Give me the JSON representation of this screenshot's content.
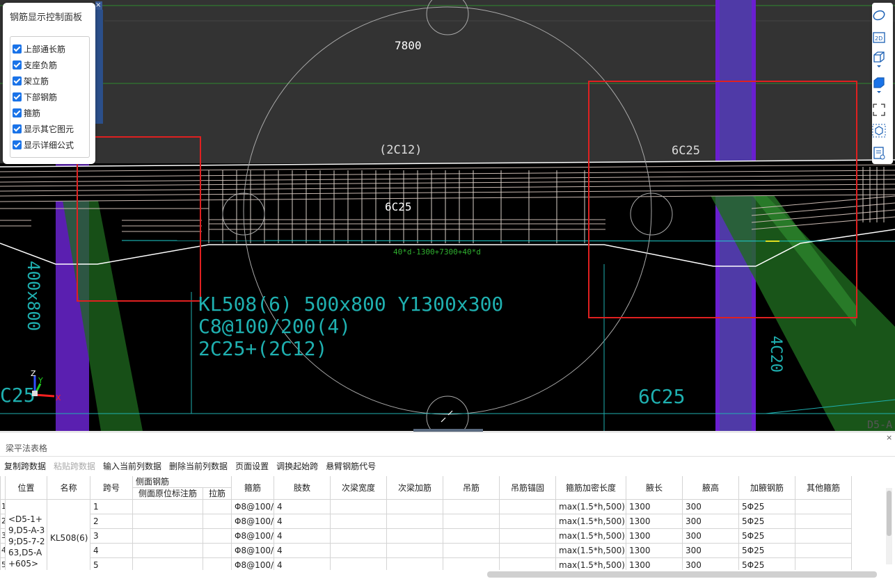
{
  "viewport": {
    "label_7800": "7800",
    "label_2c12": "(2C12)",
    "label_6c25_top": "6C25",
    "label_6c25_mid": "6C25",
    "label_6c25_bottom": "6C25",
    "label_c25_left": "C25",
    "beam_line1": "KL508(6) 500x800 Y1300x300",
    "beam_line2": "C8@100/200(4)",
    "beam_line3": "2C25+(2C12)",
    "green_formula_line2": "40*d-1300+7300+40*d",
    "left_vertical_text": "400x800",
    "right_vertical_text": "4C20",
    "corner_text": "D5-A",
    "axis_z": "Z",
    "axis_y": "Y",
    "axis_x": "X",
    "colors": {
      "bg": "#000000",
      "cyan": "#1fb0b0",
      "red": "#e02020",
      "purple": "#7a1fe0",
      "green": "#2f8a2f"
    }
  },
  "control_panel": {
    "title": "钢筋显示控制面板",
    "close_label": "×",
    "items": [
      {
        "label": "上部通长筋",
        "checked": true
      },
      {
        "label": "支座负筋",
        "checked": true
      },
      {
        "label": "架立筋",
        "checked": true
      },
      {
        "label": "下部钢筋",
        "checked": true
      },
      {
        "label": "箍筋",
        "checked": true
      },
      {
        "label": "显示其它图元",
        "checked": true
      },
      {
        "label": "显示详细公式",
        "checked": true
      }
    ]
  },
  "right_toolbar": {
    "icons": [
      "orbit-icon",
      "2d-view-icon",
      "3d-box-icon",
      "3d-solid-icon",
      "fullscreen-icon",
      "cube-view-icon",
      "report-icon"
    ],
    "label_2d": "2D"
  },
  "panel": {
    "title": "梁平法表格",
    "close_label": "×",
    "menu": [
      {
        "label": "复制跨数据",
        "enabled": true
      },
      {
        "label": "粘贴跨数据",
        "enabled": false
      },
      {
        "label": "输入当前列数据",
        "enabled": true
      },
      {
        "label": "删除当前列数据",
        "enabled": true
      },
      {
        "label": "页面设置",
        "enabled": true
      },
      {
        "label": "调换起始跨",
        "enabled": true
      },
      {
        "label": "悬臂钢筋代号",
        "enabled": true
      }
    ],
    "headers": {
      "position": "位置",
      "name": "名称",
      "span": "跨号",
      "side_group": "侧面钢筋",
      "side_orig": "侧面原位标注筋",
      "tie": "拉筋",
      "stirrup": "箍筋",
      "legs": "肢数",
      "sec_width": "次梁宽度",
      "sec_add": "次梁加筋",
      "hanger": "吊筋",
      "hanger_anchor": "吊筋锚固",
      "dense_len": "箍筋加密长度",
      "haunch_len": "腋长",
      "haunch_h": "腋高",
      "haunch_bar": "加腋钢筋",
      "other_stirrup": "其他箍筋"
    },
    "position_text": "<D5-1+9,D5-A-39;D5-7-263,D5-A+605>",
    "name_text": "KL508(6)",
    "rows": [
      {
        "num": "1",
        "span": "1",
        "stirrup": "Φ8@100/",
        "legs": "4",
        "dense": "max(1.5*h,500)",
        "hlen": "1300",
        "hh": "300",
        "hbar": "5Φ25"
      },
      {
        "num": "2",
        "span": "2",
        "stirrup": "Φ8@100/",
        "legs": "4",
        "dense": "max(1.5*h,500)",
        "hlen": "1300",
        "hh": "300",
        "hbar": "5Φ25"
      },
      {
        "num": "3",
        "span": "3",
        "stirrup": "Φ8@100/",
        "legs": "4",
        "dense": "max(1.5*h,500)",
        "hlen": "1300",
        "hh": "300",
        "hbar": "5Φ25"
      },
      {
        "num": "4",
        "span": "4",
        "stirrup": "Φ8@100/",
        "legs": "4",
        "dense": "max(1.5*h,500)",
        "hlen": "1300",
        "hh": "300",
        "hbar": "5Φ25"
      },
      {
        "num": "5",
        "span": "5",
        "stirrup": "Φ8@100/",
        "legs": "4",
        "dense": "max(1.5*h,500)",
        "hlen": "1300",
        "hh": "300",
        "hbar": "5Φ25"
      }
    ]
  }
}
